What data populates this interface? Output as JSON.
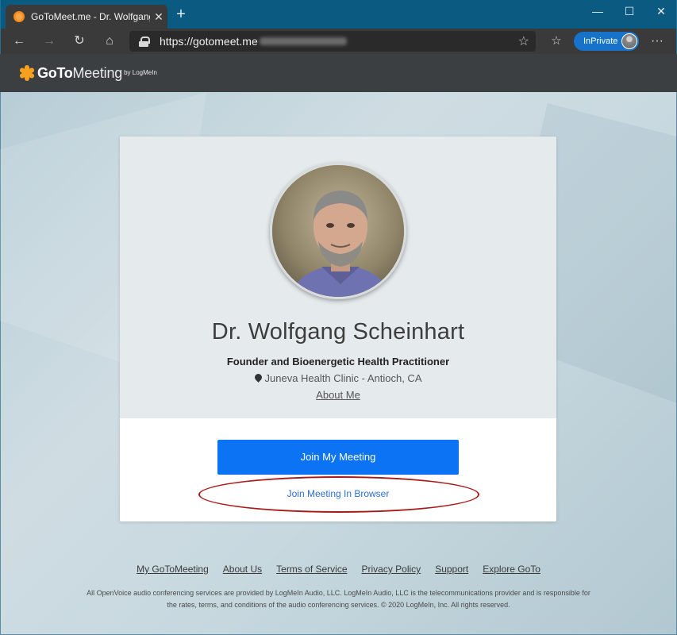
{
  "browser": {
    "tab_title": "GoToMeet.me - Dr. Wolfgang Sc",
    "tab_close": "✕",
    "new_tab": "+",
    "url": "https://gotomeet.me",
    "inprivate": "InPrivate",
    "more": "···",
    "min": "—",
    "max": "☐",
    "close": "✕",
    "back": "←",
    "forward": "→",
    "refresh": "↻",
    "home": "⌂",
    "star": "☆",
    "favs": "☆"
  },
  "site": {
    "logo_goto": "GoTo",
    "logo_meeting": "Meeting",
    "logo_by": "by LogMeIn"
  },
  "profile": {
    "name": "Dr. Wolfgang Scheinhart",
    "title": "Founder and Bioenergetic Health Practitioner",
    "location": "Juneva Health Clinic - Antioch, CA",
    "about_link": "About Me"
  },
  "actions": {
    "join_meeting": "Join My Meeting",
    "join_browser": "Join Meeting In Browser"
  },
  "footer": {
    "links": [
      "My GoToMeeting",
      "About Us",
      "Terms of Service",
      "Privacy Policy",
      "Support",
      "Explore GoTo"
    ],
    "legal_line1": "All OpenVoice audio conferencing services are provided by LogMeIn Audio, LLC. LogMeIn Audio, LLC is the telecommunications provider and is responsible for",
    "legal_line2": "the rates, terms, and conditions of the audio conferencing services. © 2020 LogMeIn, Inc. All rights reserved."
  },
  "colors": {
    "accent_button": "#0b73f4",
    "link_blue": "#2a6fd6",
    "annotation_ring": "#a81a1a",
    "inprivate_badge": "#1673c9",
    "titlebar": "#0a5a82"
  }
}
